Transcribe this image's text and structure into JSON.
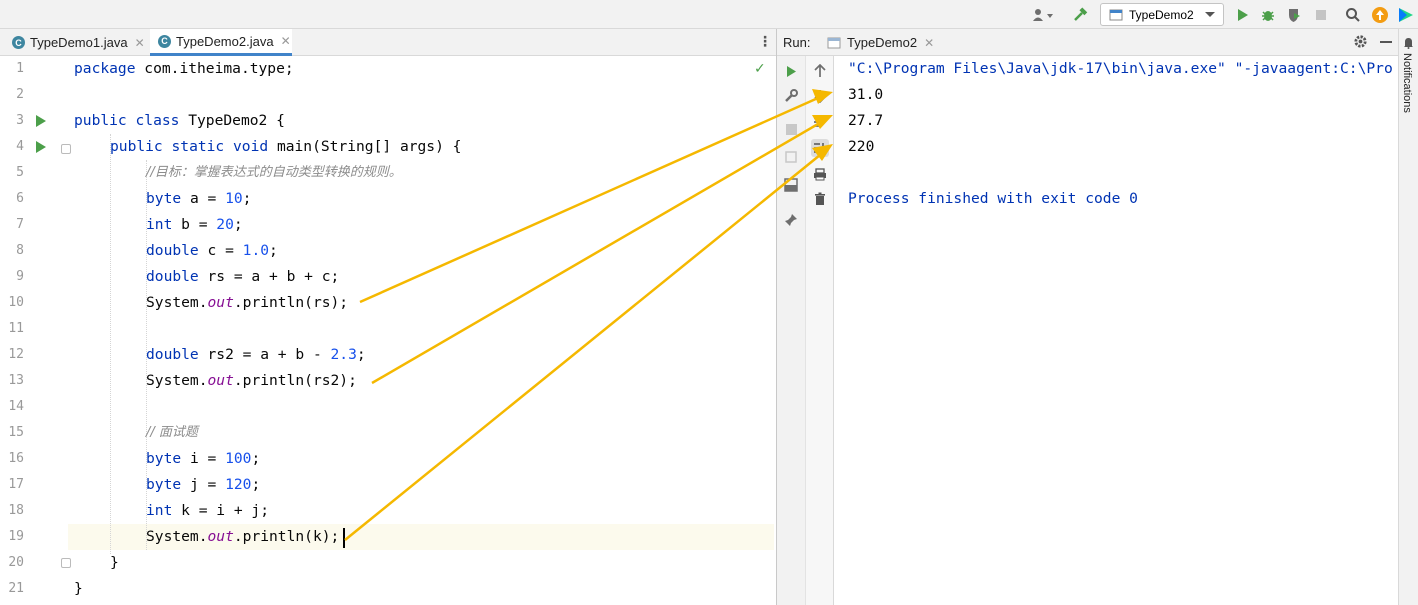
{
  "toolbar": {
    "run_config": "TypeDemo2",
    "icons": [
      "user-icon",
      "build-hammer-icon",
      "run-icon",
      "debug-icon",
      "coverage-icon",
      "stop-icon",
      "search-icon",
      "update-icon",
      "jetbrains-icon"
    ]
  },
  "editor": {
    "tabs": [
      {
        "label": "TypeDemo1.java",
        "active": false
      },
      {
        "label": "TypeDemo2.java",
        "active": true
      }
    ],
    "line_numbers": [
      "1",
      "2",
      "3",
      "4",
      "5",
      "6",
      "7",
      "8",
      "9",
      "10",
      "11",
      "12",
      "13",
      "14",
      "15",
      "16",
      "17",
      "18",
      "19",
      "20",
      "21"
    ],
    "code": {
      "l1_kw": "package",
      "l1_rest": " com.itheima.type;",
      "l3_kw": "public class",
      "l3_rest": " TypeDemo2 {",
      "l4_kw": "public static void",
      "l4_rest": " main(String[] args) {",
      "l5_comment": "//目标：掌握表达式的自动类型转换的规则。",
      "l6_kw": "byte",
      "l6_a": " a = ",
      "l6_num": "10",
      "l6_end": ";",
      "l7_kw": "int",
      "l7_a": " b = ",
      "l7_num": "20",
      "l7_end": ";",
      "l8_kw": "double",
      "l8_a": " c = ",
      "l8_num": "1.0",
      "l8_end": ";",
      "l9_kw": "double",
      "l9_rest": " rs = a + b + c;",
      "l10_a": "System.",
      "l10_field": "out",
      "l10_b": ".println(rs);",
      "l12_kw": "double",
      "l12_a": " rs2 = a + b - ",
      "l12_num": "2.3",
      "l12_end": ";",
      "l13_a": "System.",
      "l13_field": "out",
      "l13_b": ".println(rs2);",
      "l15_comment": "// 面试题",
      "l16_kw": "byte",
      "l16_a": " i = ",
      "l16_num": "100",
      "l16_end": ";",
      "l17_kw": "byte",
      "l17_a": " j = ",
      "l17_num": "120",
      "l17_end": ";",
      "l18_kw": "int",
      "l18_rest": " k = i + j;",
      "l19_a": "System.",
      "l19_field": "out",
      "l19_b": ".println(k);",
      "l20": "}",
      "l21": "}"
    }
  },
  "run": {
    "label": "Run:",
    "tab": "TypeDemo2",
    "console": {
      "command": "\"C:\\Program Files\\Java\\jdk-17\\bin\\java.exe\" \"-javaagent:C:\\Pro",
      "outputs": [
        "31.0",
        "27.7",
        "220"
      ],
      "exit": "Process finished with exit code 0"
    }
  },
  "sidebar_right": {
    "notifications": "Notifications"
  },
  "colors": {
    "annotation_arrow": "#f5b800",
    "keyword": "#0033b3",
    "number": "#1750eb",
    "field": "#871094",
    "comment": "#8c8c8c",
    "run_green": "#4c9f4a"
  }
}
